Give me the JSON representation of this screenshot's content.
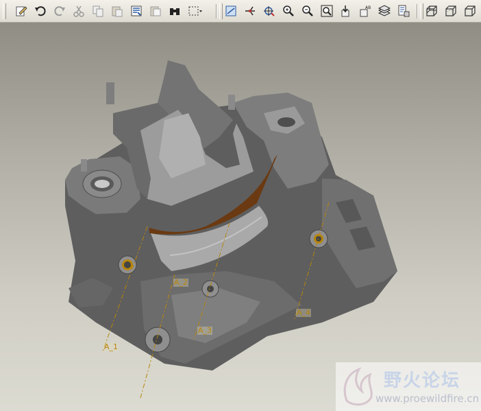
{
  "toolbar": {
    "groups": [
      [
        "edit-icon",
        "undo-icon",
        "redo-icon",
        "cut-icon",
        "copy-icon",
        "paste-icon",
        "paste-special-icon",
        "regenerate-icon",
        "binoculars-icon",
        "select-box-icon"
      ],
      [
        "datum-display-icon",
        "datum-axis-icon",
        "spin-center-icon",
        "zoom-in-icon",
        "zoom-out-icon",
        "refit-icon",
        "datum-point-icon",
        "axis-tag-icon",
        "layers-icon",
        "model-tree-icon"
      ],
      [
        "wireframe-icon",
        "hidden-line-icon",
        "no-hidden-icon"
      ]
    ]
  },
  "viewport": {
    "axis_labels": [
      "A_1",
      "A_2",
      "A_3",
      "A_4"
    ]
  },
  "watermark": {
    "title": "野火论坛",
    "url": "www.proewildfire.cn"
  },
  "colors": {
    "background_top": "#8f8d84",
    "background_bottom": "#dcdbd2",
    "model_gray": "#6f6f6f",
    "axis_orange": "#b7860c",
    "seal_brown": "#6b3a12"
  }
}
